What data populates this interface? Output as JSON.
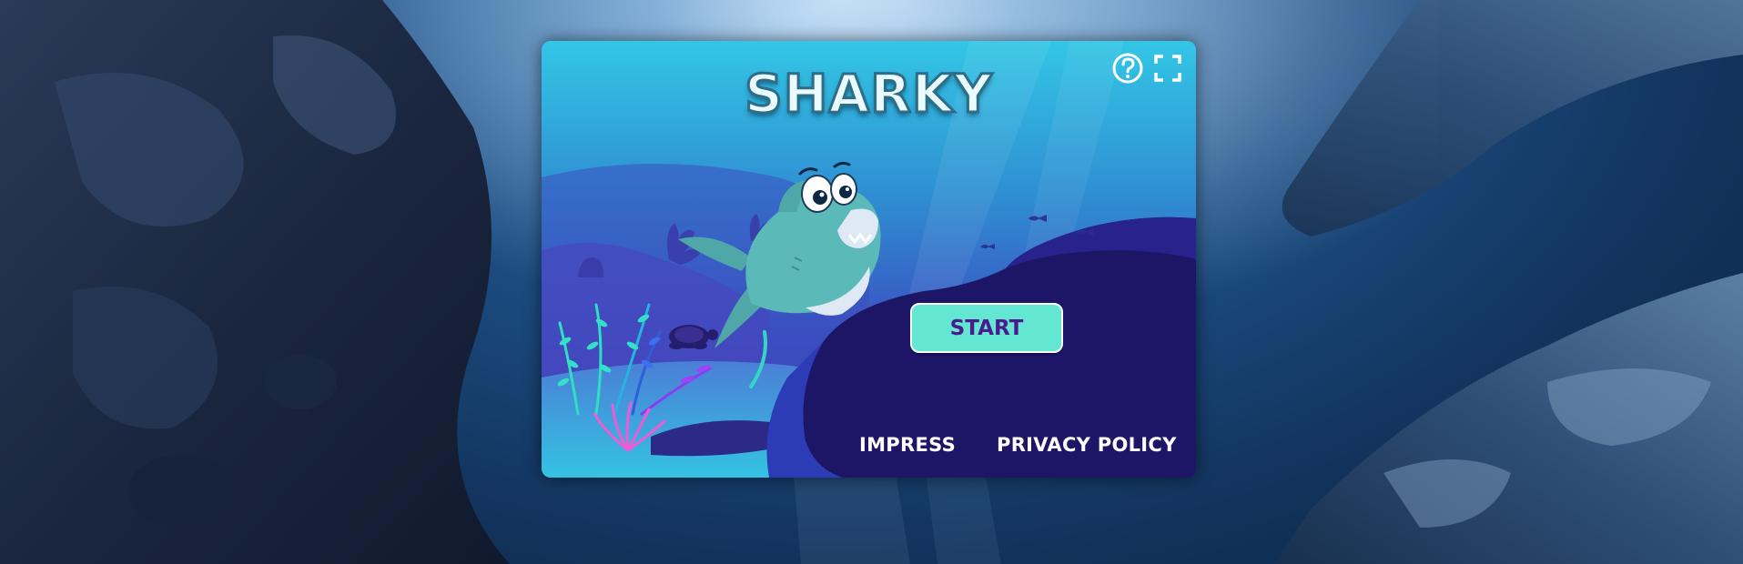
{
  "game": {
    "title": "SHARKY",
    "start_label": "START",
    "links": {
      "impress": "IMPRESS",
      "privacy": "PRIVACY POLICY"
    },
    "icons": {
      "help": "help-icon",
      "fullscreen": "fullscreen-icon"
    }
  },
  "colors": {
    "start_button": "#63e6d2",
    "start_text": "#4b1a8c",
    "deep_panel": "#1d1566",
    "title_fill": "#e9fbff"
  }
}
